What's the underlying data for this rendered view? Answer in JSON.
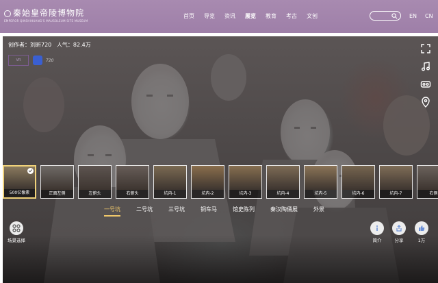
{
  "header": {
    "logo_cn": "秦始皇帝陵博物院",
    "logo_en": "EMPEROR QINSHIHUANG'S MAUSOLEUM SITE MUSEUM",
    "nav": [
      "首页",
      "导览",
      "资讯",
      "展览",
      "教育",
      "考古",
      "文创"
    ],
    "active_nav": "展览",
    "search_placeholder": "",
    "lang_en": "EN",
    "lang_cn": "CN"
  },
  "pano": {
    "author": "创作者：刘昕720",
    "popularity": "人气：82.4万",
    "badge1": "VR",
    "badge3": "720"
  },
  "thumbnails": [
    {
      "label": "500亿像素",
      "selected": true
    },
    {
      "label": "正面左侧",
      "selected": false
    },
    {
      "label": "左俯头",
      "selected": false
    },
    {
      "label": "右俯头",
      "selected": false
    },
    {
      "label": "坑内-1",
      "selected": false
    },
    {
      "label": "坑内-2",
      "selected": false
    },
    {
      "label": "坑内-3",
      "selected": false
    },
    {
      "label": "坑内-4",
      "selected": false
    },
    {
      "label": "坑内-5",
      "selected": false
    },
    {
      "label": "坑内-6",
      "selected": false
    },
    {
      "label": "坑内-7",
      "selected": false
    },
    {
      "label": "右侧",
      "selected": false
    }
  ],
  "tabs": [
    "一号坑",
    "二号坑",
    "三号坑",
    "铜车马",
    "馆史陈列",
    "秦汉陶俑展",
    "外景"
  ],
  "active_tab": "一号坑",
  "controls": {
    "scene_select": "场景选择",
    "intro": "简介",
    "share": "分享",
    "likes": "1万"
  },
  "colors": {
    "header_bg": "#a88ab0",
    "active_tab": "#f0c86a"
  }
}
